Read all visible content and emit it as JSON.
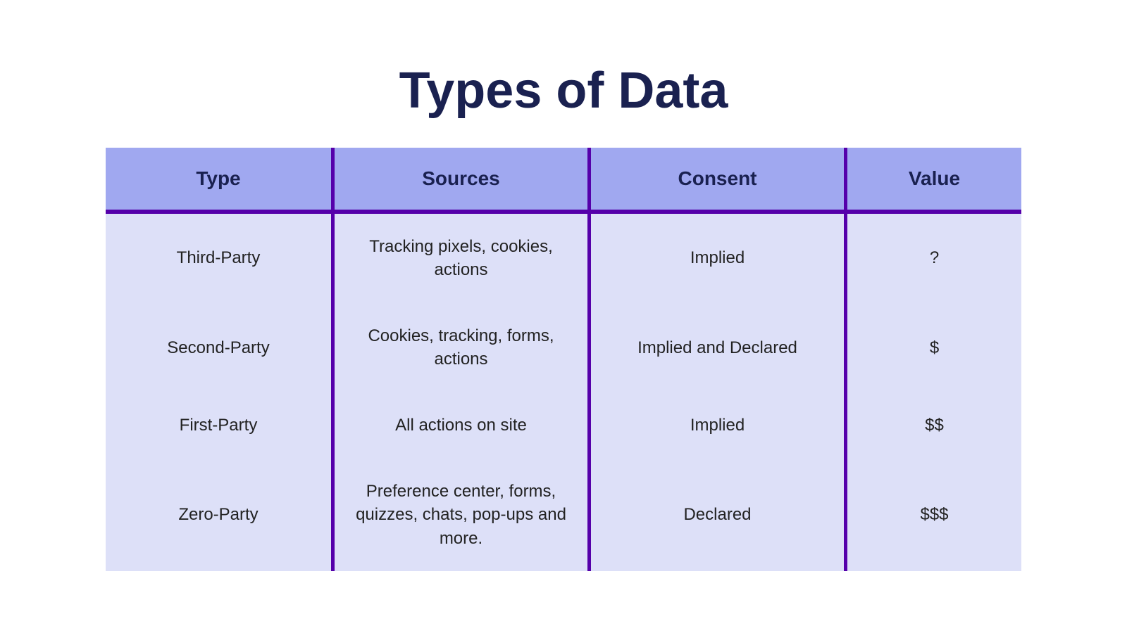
{
  "title": "Types of Data",
  "table": {
    "headers": [
      {
        "id": "type",
        "label": "Type"
      },
      {
        "id": "sources",
        "label": "Sources"
      },
      {
        "id": "consent",
        "label": "Consent"
      },
      {
        "id": "value",
        "label": "Value"
      }
    ],
    "rows": [
      {
        "type": "Third-Party",
        "sources": "Tracking pixels, cookies, actions",
        "consent": "Implied",
        "value": "?"
      },
      {
        "type": "Second-Party",
        "sources": "Cookies, tracking, forms, actions",
        "consent": "Implied and Declared",
        "value": "$"
      },
      {
        "type": "First-Party",
        "sources": "All actions on site",
        "consent": "Implied",
        "value": "$$"
      },
      {
        "type": "Zero-Party",
        "sources": "Preference center, forms, quizzes, chats, pop-ups and more.",
        "consent": "Declared",
        "value": "$$$"
      }
    ]
  }
}
